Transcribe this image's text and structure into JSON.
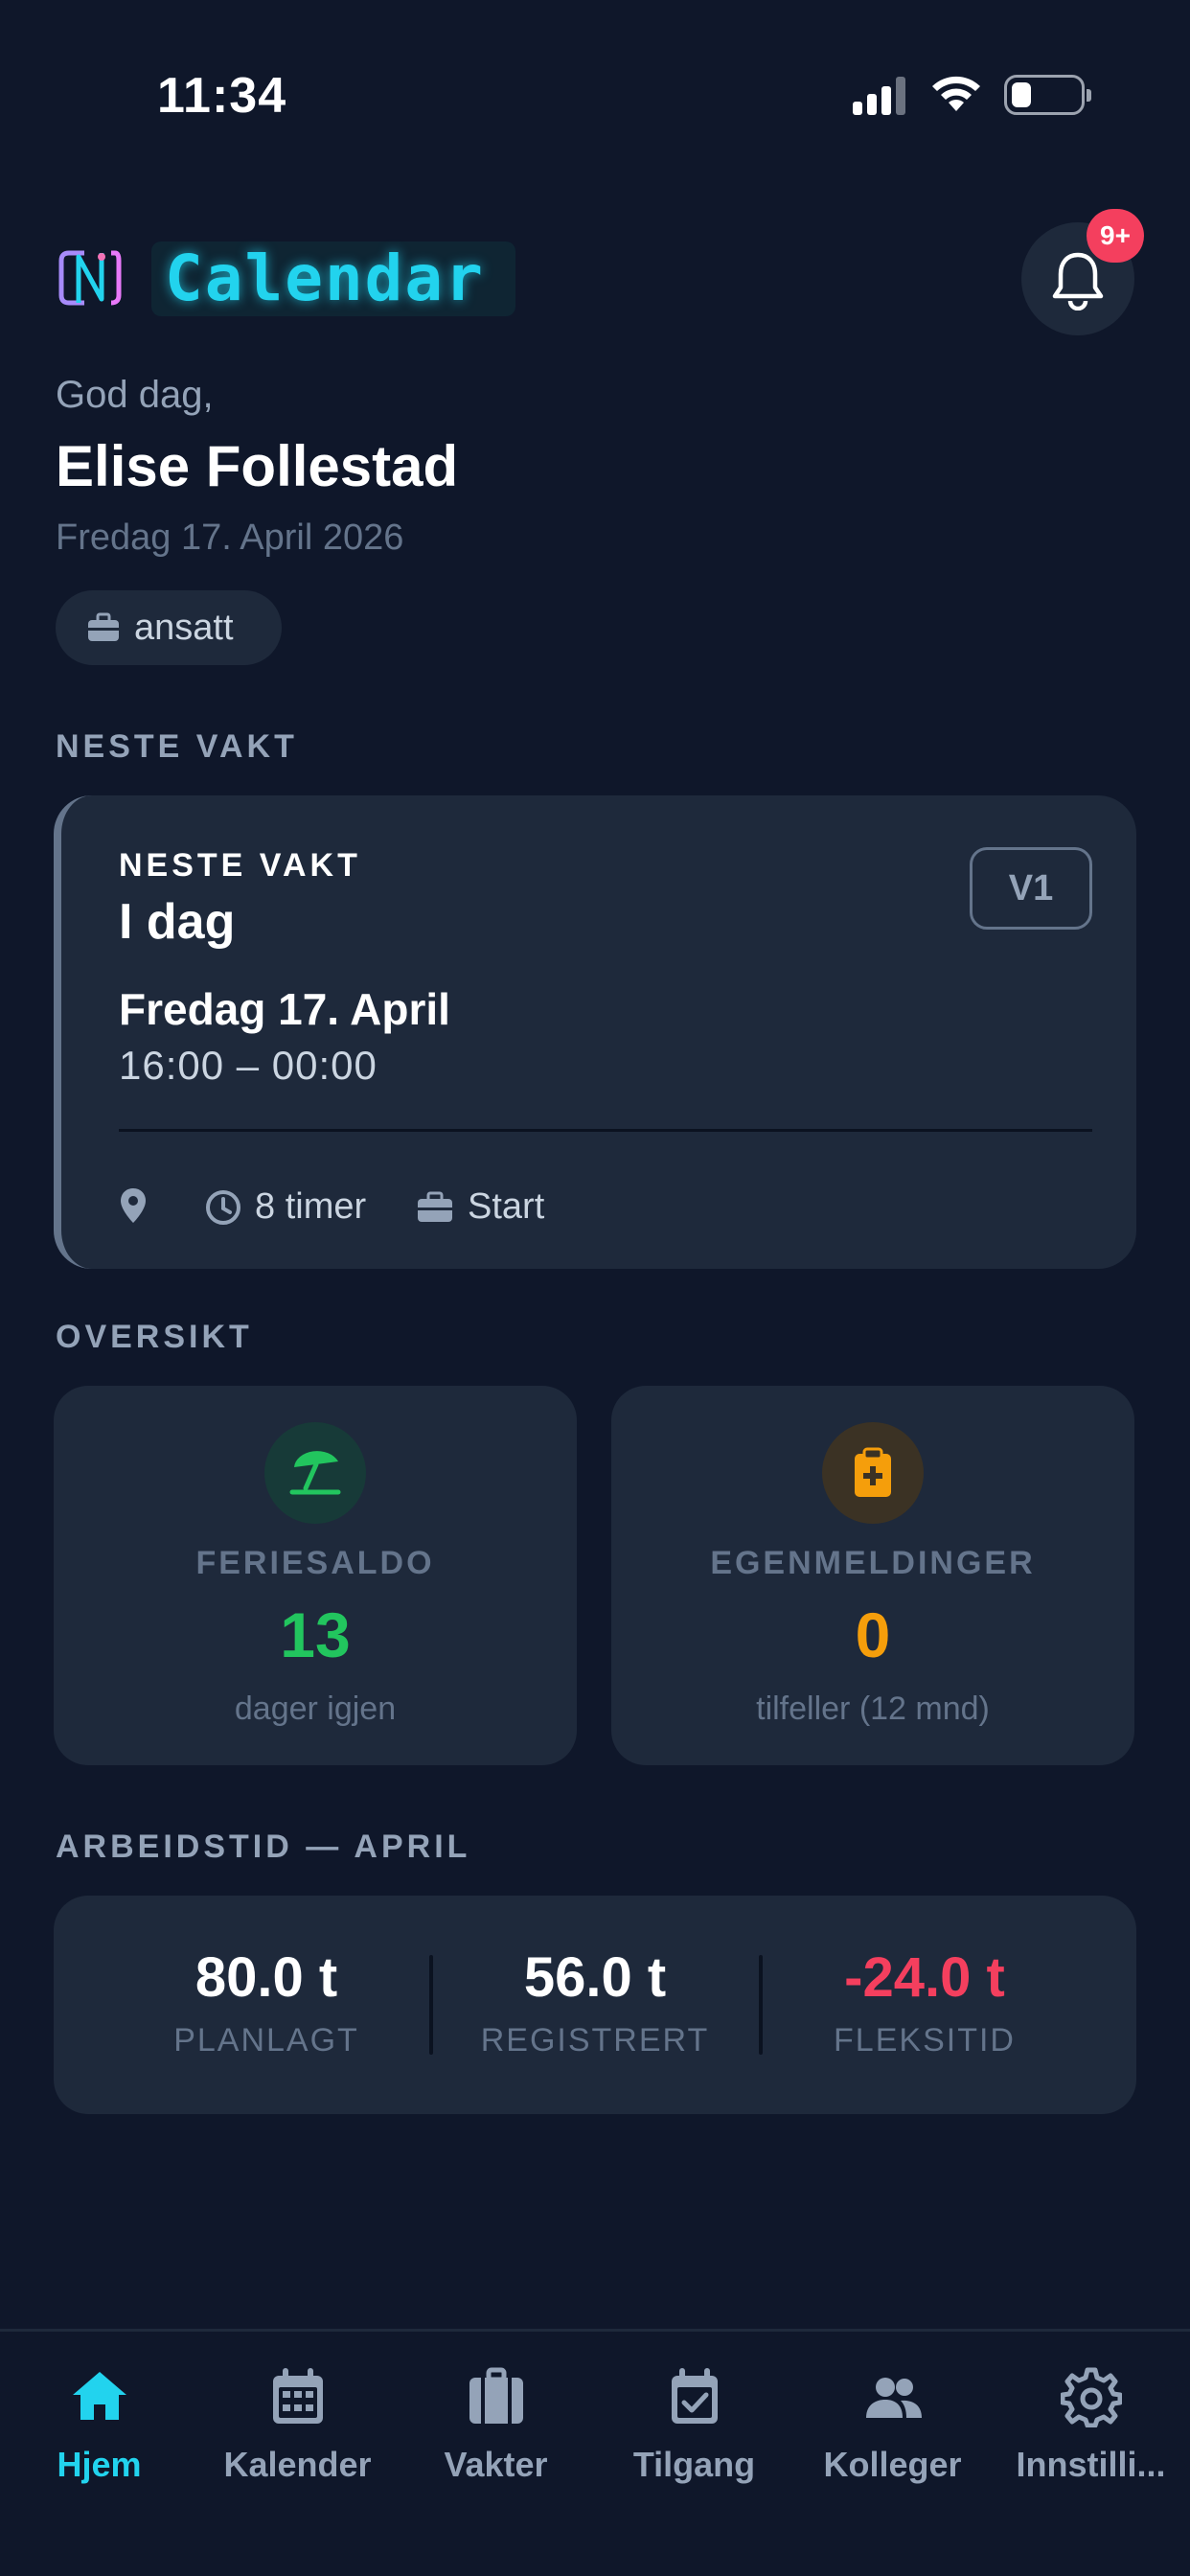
{
  "status_bar": {
    "time": "11:34"
  },
  "header": {
    "app_name": "Calendar",
    "notification_badge": "9+"
  },
  "user": {
    "greeting": "God dag,",
    "name": "Elise Follestad",
    "date": "Fredag 17. April 2026",
    "role": "ansatt"
  },
  "next_shift_section": {
    "label": "NESTE VAKT"
  },
  "next_shift": {
    "label": "NESTE VAKT",
    "day": "I dag",
    "date": "Fredag 17. April",
    "time": "16:00 – 00:00",
    "tag": "V1",
    "duration": "8 timer",
    "type": "Start"
  },
  "overview": {
    "label": "OVERSIKT",
    "vacation": {
      "title": "FERIESALDO",
      "value": "13",
      "sub": "dager igjen",
      "color": "#22c55e"
    },
    "sick": {
      "title": "EGENMELDINGER",
      "value": "0",
      "sub": "tilfeller (12 mnd)",
      "color": "#f59e0b"
    }
  },
  "work_hours": {
    "label": "ARBEIDSTID — APRIL",
    "planned": {
      "value": "80.0 t",
      "label": "PLANLAGT"
    },
    "registered": {
      "value": "56.0 t",
      "label": "REGISTRERT"
    },
    "flex": {
      "value": "-24.0 t",
      "label": "FLEKSITID",
      "color": "#f43f5e"
    }
  },
  "tabs": [
    {
      "label": "Hjem",
      "icon": "home-icon",
      "active": true
    },
    {
      "label": "Kalender",
      "icon": "calendar-icon",
      "active": false
    },
    {
      "label": "Vakter",
      "icon": "briefcase-icon",
      "active": false
    },
    {
      "label": "Tilgang",
      "icon": "calendar-check-icon",
      "active": false
    },
    {
      "label": "Kolleger",
      "icon": "users-icon",
      "active": false
    },
    {
      "label": "Innstilli...",
      "icon": "gear-icon",
      "active": false
    }
  ],
  "colors": {
    "accent": "#22d3ee",
    "background": "#0f172a",
    "card": "#1e293b"
  }
}
